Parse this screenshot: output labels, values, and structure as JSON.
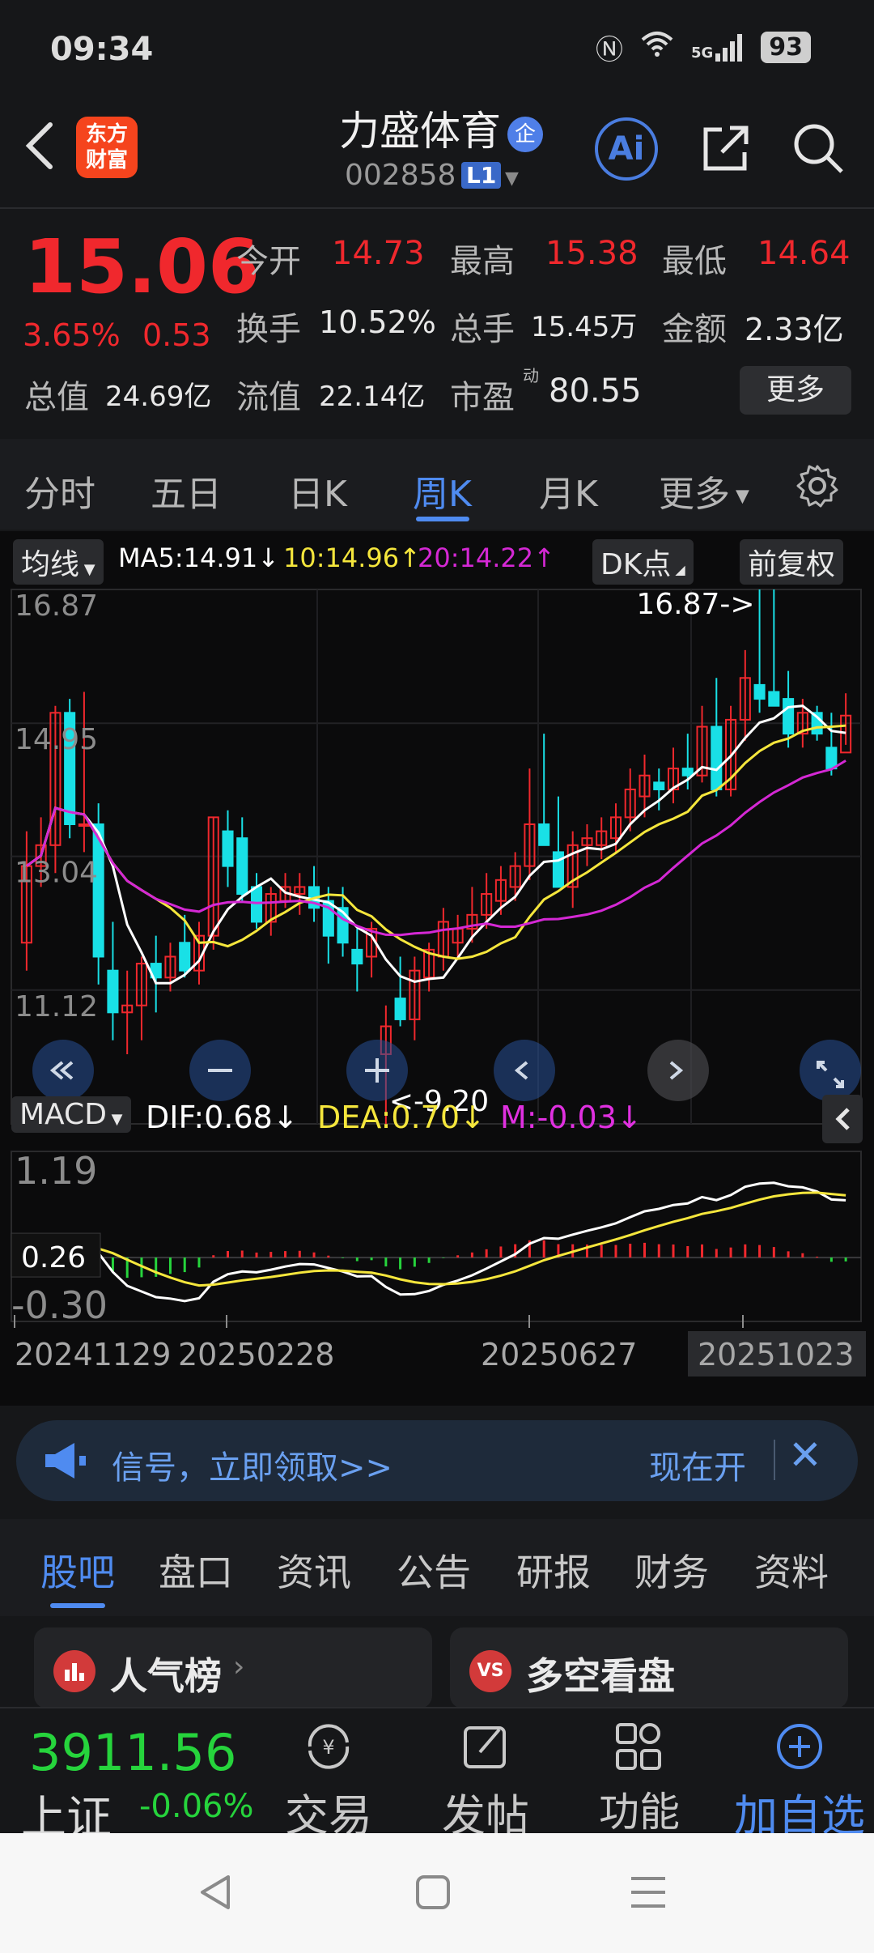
{
  "status_bar": {
    "time": "09:34",
    "battery": "93",
    "signal_label": "5G"
  },
  "header": {
    "logo_text": "东方财富",
    "stock_name": "力盛体育",
    "qi_badge": "企",
    "stock_code": "002858",
    "level_badge": "L1",
    "ai_label": "Ai"
  },
  "quote": {
    "price": "15.06",
    "pct_change": "3.65%",
    "abs_change": "0.53",
    "rows": [
      [
        {
          "label": "今开",
          "value": "14.73",
          "red": true
        },
        {
          "label": "最高",
          "value": "15.38",
          "red": true
        },
        {
          "label": "最低",
          "value": "14.64",
          "red": true
        }
      ],
      [
        {
          "label": "换手",
          "value": "10.52%"
        },
        {
          "label": "总手",
          "value": "15.45万"
        },
        {
          "label": "金额",
          "value": "2.33亿"
        }
      ],
      [
        {
          "label": "总值",
          "value": "24.69亿"
        },
        {
          "label": "流值",
          "value": "22.14亿"
        },
        {
          "label": "市盈",
          "sup": "动",
          "value": "80.55"
        }
      ]
    ],
    "more_button": "更多"
  },
  "period_tabs": {
    "items": [
      "分时",
      "五日",
      "日K",
      "周K",
      "月K",
      "更多"
    ],
    "active": "周K"
  },
  "chart_data": {
    "type": "candlestick",
    "title": "",
    "period": "weekly",
    "ma_selector": "均线",
    "ma_legend": {
      "ma5": "MA5:14.91↓",
      "ma10": "10:14.96↑",
      "ma20": "20:14.22↑"
    },
    "dk_button": "DK点",
    "adjust_button": "前复权",
    "y_ticks": [
      "16.87",
      "14.95",
      "13.04",
      "11.12",
      "9.20"
    ],
    "ylim": [
      9.2,
      16.87
    ],
    "high_marker": "16.87->",
    "low_marker": "<-9.20",
    "x_labels": [
      "20241129",
      "20250228",
      "20250627",
      "20251023"
    ],
    "candles": [
      {
        "o": 11.8,
        "h": 13.4,
        "l": 11.4,
        "c": 12.9
      },
      {
        "o": 12.9,
        "h": 13.6,
        "l": 12.6,
        "c": 13.2
      },
      {
        "o": 13.2,
        "h": 15.2,
        "l": 12.8,
        "c": 15.1
      },
      {
        "o": 15.1,
        "h": 15.3,
        "l": 13.3,
        "c": 13.5
      },
      {
        "o": 13.5,
        "h": 15.4,
        "l": 13.1,
        "c": 13.5
      },
      {
        "o": 13.5,
        "h": 13.8,
        "l": 11.2,
        "c": 11.6
      },
      {
        "o": 11.4,
        "h": 12.1,
        "l": 10.4,
        "c": 10.8
      },
      {
        "o": 10.8,
        "h": 11.4,
        "l": 10.2,
        "c": 10.9
      },
      {
        "o": 10.9,
        "h": 11.6,
        "l": 10.4,
        "c": 11.5
      },
      {
        "o": 11.5,
        "h": 11.9,
        "l": 10.8,
        "c": 11.3
      },
      {
        "o": 11.3,
        "h": 11.8,
        "l": 11.1,
        "c": 11.6
      },
      {
        "o": 11.8,
        "h": 12.2,
        "l": 11.3,
        "c": 11.4
      },
      {
        "o": 11.4,
        "h": 12.1,
        "l": 11.2,
        "c": 11.9
      },
      {
        "o": 11.9,
        "h": 13.6,
        "l": 11.7,
        "c": 13.6
      },
      {
        "o": 13.4,
        "h": 13.7,
        "l": 12.6,
        "c": 12.9
      },
      {
        "o": 13.3,
        "h": 13.6,
        "l": 12.4,
        "c": 12.5
      },
      {
        "o": 12.6,
        "h": 12.8,
        "l": 12.0,
        "c": 12.1
      },
      {
        "o": 12.1,
        "h": 12.6,
        "l": 11.9,
        "c": 12.5
      },
      {
        "o": 12.4,
        "h": 12.8,
        "l": 12.3,
        "c": 12.6
      },
      {
        "o": 12.5,
        "h": 12.8,
        "l": 12.2,
        "c": 12.6
      },
      {
        "o": 12.6,
        "h": 12.9,
        "l": 12.1,
        "c": 12.3
      },
      {
        "o": 12.4,
        "h": 12.6,
        "l": 11.5,
        "c": 11.9
      },
      {
        "o": 12.3,
        "h": 12.6,
        "l": 11.6,
        "c": 11.8
      },
      {
        "o": 11.7,
        "h": 12.0,
        "l": 11.1,
        "c": 11.5
      },
      {
        "o": 11.6,
        "h": 12.1,
        "l": 11.3,
        "c": 12.0
      },
      {
        "o": 10.2,
        "h": 10.9,
        "l": 9.2,
        "c": 10.6
      },
      {
        "o": 11.0,
        "h": 11.6,
        "l": 10.6,
        "c": 10.7
      },
      {
        "o": 10.7,
        "h": 11.6,
        "l": 10.4,
        "c": 11.4
      },
      {
        "o": 11.3,
        "h": 11.8,
        "l": 11.1,
        "c": 11.7
      },
      {
        "o": 11.6,
        "h": 12.3,
        "l": 11.4,
        "c": 12.1
      },
      {
        "o": 11.8,
        "h": 12.2,
        "l": 11.6,
        "c": 12.0
      },
      {
        "o": 12.0,
        "h": 12.6,
        "l": 11.8,
        "c": 12.2
      },
      {
        "o": 12.2,
        "h": 12.8,
        "l": 12.0,
        "c": 12.5
      },
      {
        "o": 12.4,
        "h": 12.9,
        "l": 12.2,
        "c": 12.7
      },
      {
        "o": 12.6,
        "h": 13.1,
        "l": 12.4,
        "c": 12.9
      },
      {
        "o": 12.9,
        "h": 14.3,
        "l": 12.7,
        "c": 13.5
      },
      {
        "o": 13.5,
        "h": 14.8,
        "l": 13.2,
        "c": 13.2
      },
      {
        "o": 13.1,
        "h": 13.9,
        "l": 12.6,
        "c": 12.6
      },
      {
        "o": 12.6,
        "h": 13.4,
        "l": 12.3,
        "c": 13.2
      },
      {
        "o": 13.2,
        "h": 13.5,
        "l": 12.9,
        "c": 13.3
      },
      {
        "o": 13.2,
        "h": 13.6,
        "l": 13.0,
        "c": 13.4
      },
      {
        "o": 13.3,
        "h": 13.8,
        "l": 13.1,
        "c": 13.6
      },
      {
        "o": 13.6,
        "h": 14.3,
        "l": 13.4,
        "c": 14.0
      },
      {
        "o": 13.9,
        "h": 14.5,
        "l": 13.6,
        "c": 14.2
      },
      {
        "o": 14.1,
        "h": 14.3,
        "l": 13.7,
        "c": 14.0
      },
      {
        "o": 14.0,
        "h": 14.6,
        "l": 13.8,
        "c": 14.3
      },
      {
        "o": 14.3,
        "h": 14.8,
        "l": 14.0,
        "c": 14.2
      },
      {
        "o": 14.2,
        "h": 15.2,
        "l": 14.1,
        "c": 14.9
      },
      {
        "o": 14.9,
        "h": 15.6,
        "l": 13.9,
        "c": 14.0
      },
      {
        "o": 14.0,
        "h": 15.2,
        "l": 13.9,
        "c": 15.0
      },
      {
        "o": 15.0,
        "h": 16.0,
        "l": 14.7,
        "c": 15.6
      },
      {
        "o": 15.5,
        "h": 16.87,
        "l": 15.1,
        "c": 15.3
      },
      {
        "o": 15.4,
        "h": 16.87,
        "l": 15.2,
        "c": 15.2
      },
      {
        "o": 15.3,
        "h": 15.7,
        "l": 14.6,
        "c": 14.8
      },
      {
        "o": 14.8,
        "h": 15.3,
        "l": 14.6,
        "c": 15.1
      },
      {
        "o": 15.1,
        "h": 15.2,
        "l": 14.7,
        "c": 14.8
      },
      {
        "o": 14.6,
        "h": 15.1,
        "l": 14.2,
        "c": 14.3
      },
      {
        "o": 14.53,
        "h": 15.38,
        "l": 14.64,
        "c": 15.06
      }
    ],
    "macd": {
      "selector": "MACD",
      "dif_label": "DIF:0.68↓",
      "dea_label": "DEA:0.70↓",
      "m_label": "M:-0.03↓",
      "y_ticks": [
        "1.19",
        "0.26",
        "-0.30"
      ],
      "ylim": [
        -0.3,
        1.19
      ]
    }
  },
  "banner": {
    "text": "信号，立即领取>>",
    "right_text": "现在开"
  },
  "info_tabs": {
    "items": [
      "股吧",
      "盘口",
      "资讯",
      "公告",
      "研报",
      "财务",
      "资料"
    ],
    "active": "股吧"
  },
  "cards": [
    {
      "icon": "bar-chart-icon",
      "title": "人气榜"
    },
    {
      "icon": "vs-icon",
      "title": "多空看盘",
      "icon_text": "VS"
    }
  ],
  "bottom_nav": {
    "index_value": "3911.56",
    "index_name": "上证",
    "index_pct": "-0.06%",
    "items": [
      "交易",
      "发帖",
      "功能",
      "加自选"
    ]
  },
  "colors": {
    "up": "#f0282d",
    "down": "#19e0e6",
    "ma5": "#ffffff",
    "ma10": "#f5e63c",
    "ma20": "#d428d4",
    "accent": "#4f8bf0"
  }
}
